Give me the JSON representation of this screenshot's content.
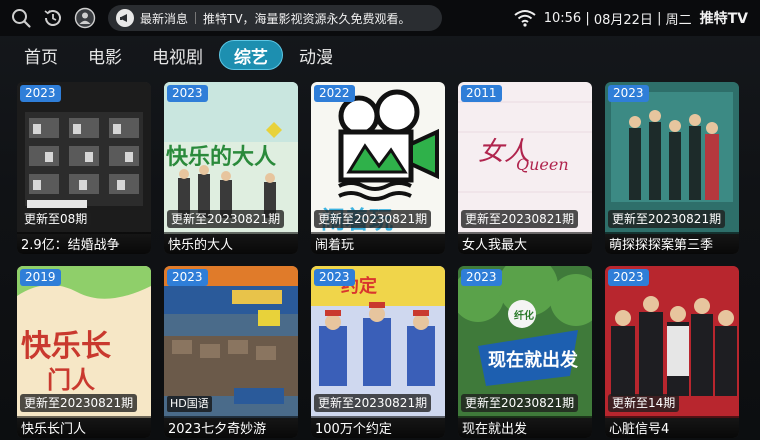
{
  "topbar": {
    "ticker_label": "最新消息",
    "ticker_message": "推特TV，海量影视资源永久免费观看。",
    "time": "10:56",
    "date": "08月22日",
    "weekday": "周二",
    "brand": "推特TV"
  },
  "icons": {
    "search": "search-icon",
    "history": "history-icon",
    "user": "user-icon",
    "bell": "bell-icon",
    "wifi": "wifi-icon"
  },
  "nav": {
    "items": [
      {
        "label": "首页"
      },
      {
        "label": "电影"
      },
      {
        "label": "电视剧"
      },
      {
        "label": "综艺",
        "active": true
      },
      {
        "label": "动漫"
      }
    ]
  },
  "colors": {
    "accent": "#1d8fb0",
    "year_badge": "#2f7ed8"
  },
  "cards": [
    {
      "year": "2023",
      "update": "更新至08期",
      "title": "2.9亿：结婚战争"
    },
    {
      "year": "2023",
      "update": "更新至20230821期",
      "title": "快乐的大人"
    },
    {
      "year": "2022",
      "update": "更新至20230821期",
      "title": "闹着玩"
    },
    {
      "year": "2011",
      "update": "更新至20230821期",
      "title": "女人我最大"
    },
    {
      "year": "2023",
      "update": "更新至20230821期",
      "title": "萌探探探案第三季"
    },
    {
      "year": "2019",
      "update": "更新至20230821期",
      "title": "快乐长门人"
    },
    {
      "year": "2023",
      "update": "HD国语",
      "title": "2023七夕奇妙游"
    },
    {
      "year": "2023",
      "update": "更新至20230821期",
      "title": "100万个约定"
    },
    {
      "year": "2023",
      "update": "更新至20230821期",
      "title": "现在就出发"
    },
    {
      "year": "2023",
      "update": "更新至14期",
      "title": "心脏信号4"
    }
  ]
}
